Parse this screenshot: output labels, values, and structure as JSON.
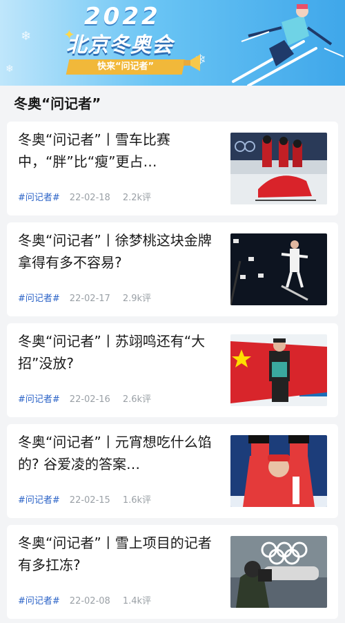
{
  "banner": {
    "year": "2022",
    "title": "北京冬奥会",
    "ribbon": "快来“问记者”"
  },
  "section": {
    "title": "冬奥“问记者”"
  },
  "articles": [
    {
      "title": "冬奥“问记者”丨雪车比赛中，“胖”比“瘦”更占…",
      "tag": "#问记者#",
      "date": "22-02-18",
      "comments": "2.2k评",
      "image": "bobsled-photo"
    },
    {
      "title": "冬奥“问记者”丨徐梦桃这块金牌拿得有多不容易?",
      "tag": "#问记者#",
      "date": "22-02-17",
      "comments": "2.9k评",
      "image": "aerial-ski-photo"
    },
    {
      "title": "冬奥“问记者”丨苏翊鸣还有“大招”没放?",
      "tag": "#问记者#",
      "date": "22-02-16",
      "comments": "2.6k评",
      "image": "snowboarder-flag-photo"
    },
    {
      "title": "冬奥“问记者”丨元宵想吃什么馅的? 谷爱凌的答案…",
      "tag": "#问记者#",
      "date": "22-02-15",
      "comments": "1.6k评",
      "image": "freeski-athlete-photo"
    },
    {
      "title": "冬奥“问记者”丨雪上项目的记者有多扛冻?",
      "tag": "#问记者#",
      "date": "22-02-08",
      "comments": "1.4k评",
      "image": "photographer-photo"
    }
  ]
}
